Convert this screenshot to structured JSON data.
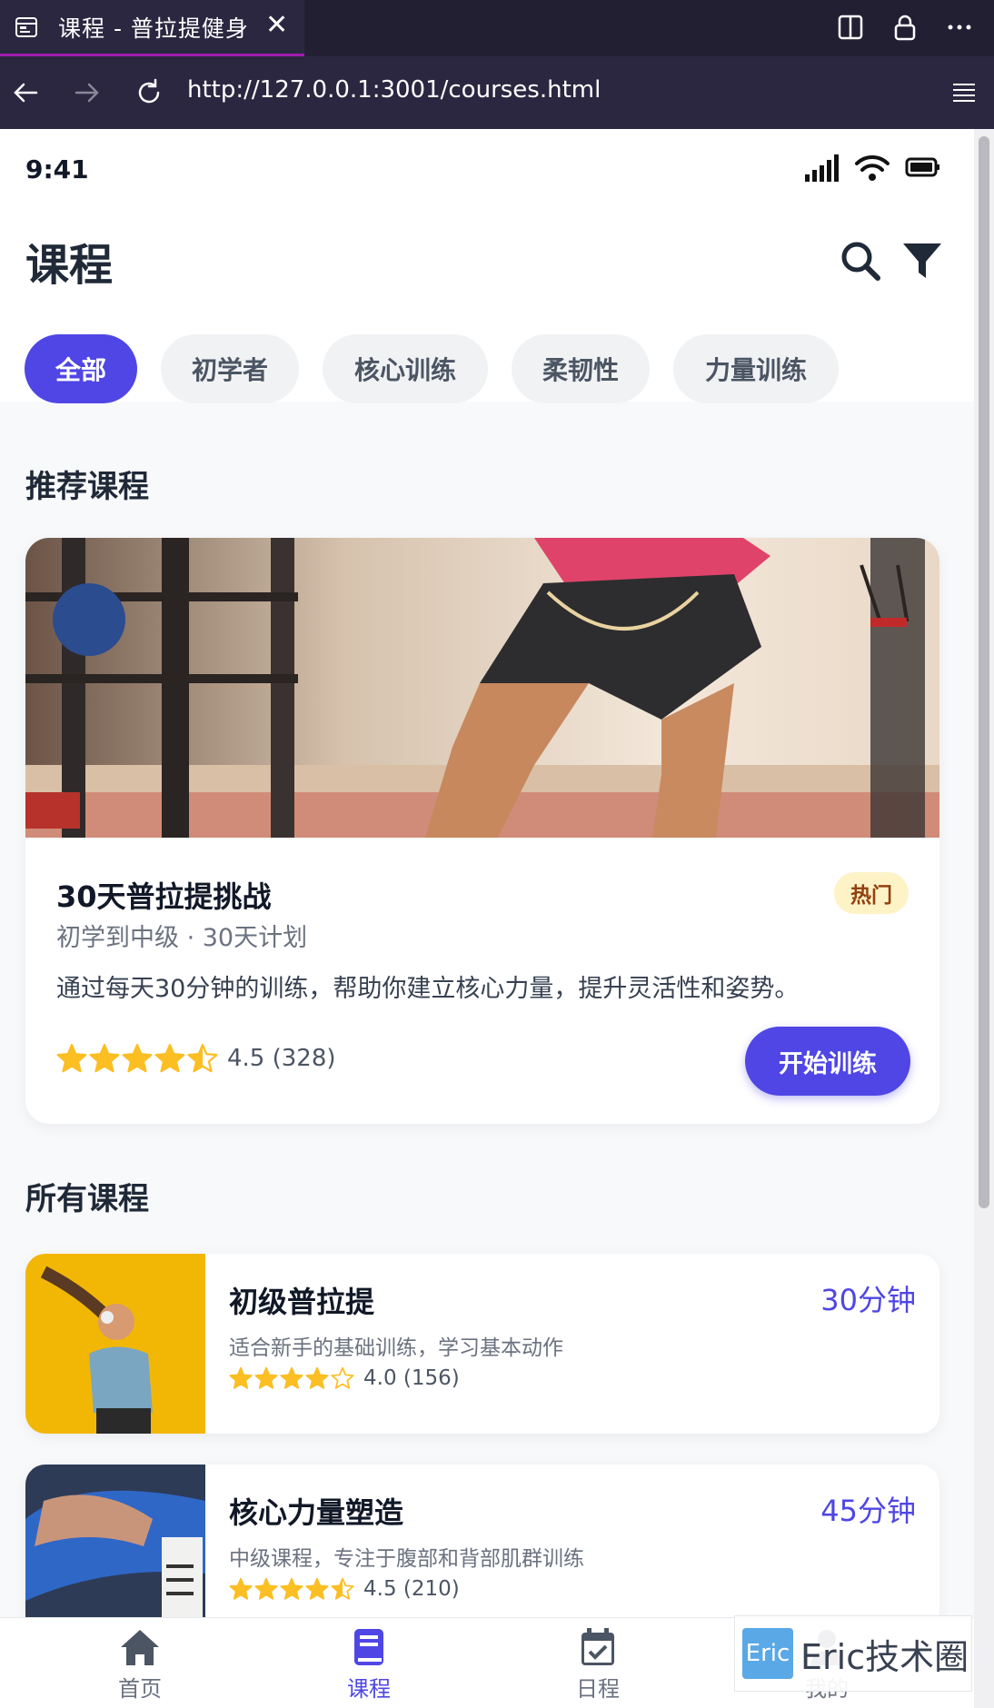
{
  "browser": {
    "tab_title": "课程 - 普拉提健身",
    "url": "http://127.0.0.1:3001/courses.html"
  },
  "status": {
    "time": "9:41"
  },
  "header": {
    "title": "课程"
  },
  "filters": [
    "全部",
    "初学者",
    "核心训练",
    "柔韧性",
    "力量训练"
  ],
  "recommended": {
    "section_title": "推荐课程",
    "title": "30天普拉提挑战",
    "meta": "初学到中级 · 30天计划",
    "description": "通过每天30分钟的训练，帮助你建立核心力量，提升灵活性和姿势。",
    "badge": "热门",
    "rating": 4.5,
    "rating_text": "4.5 (328)",
    "button": "开始训练"
  },
  "all_courses": {
    "section_title": "所有课程",
    "items": [
      {
        "title": "初级普拉提",
        "duration": "30分钟",
        "description": "适合新手的基础训练，学习基本动作",
        "rating": 4.0,
        "rating_text": "4.0 (156)"
      },
      {
        "title": "核心力量塑造",
        "duration": "45分钟",
        "description": "中级课程，专注于腹部和背部肌群训练",
        "rating": 4.5,
        "rating_text": "4.5 (210)"
      }
    ]
  },
  "bottom_nav": [
    {
      "label": "首页",
      "icon": "home-icon"
    },
    {
      "label": "课程",
      "icon": "book-icon",
      "active": true
    },
    {
      "label": "日程",
      "icon": "calendar-check-icon"
    },
    {
      "label": "我的",
      "icon": "user-icon"
    }
  ],
  "watermark": {
    "logo": "Eric",
    "text": "Eric技术圈"
  },
  "colors": {
    "accent": "#4f46e5",
    "star": "#fbbf24",
    "badge_bg": "#fef3c7",
    "badge_text": "#92400e"
  }
}
